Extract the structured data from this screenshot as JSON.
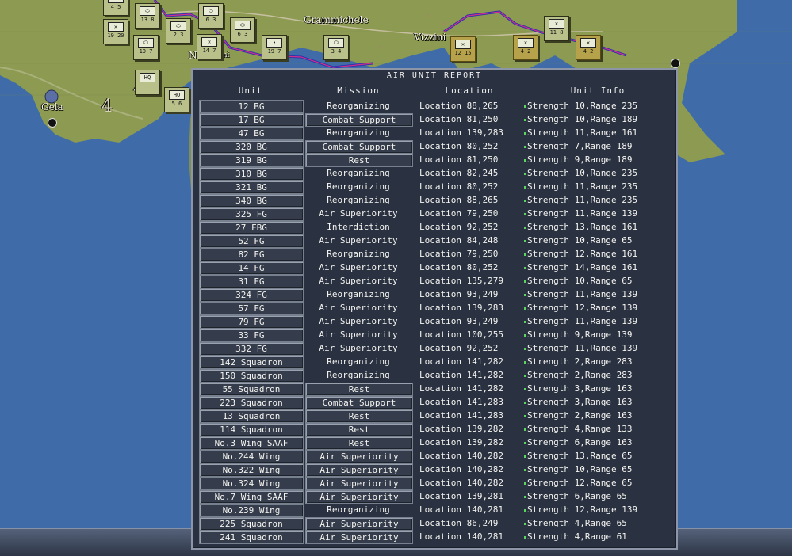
{
  "map": {
    "towns": [
      {
        "name": "Grammichele",
        "label": "Grammichele"
      },
      {
        "name": "Vizzini",
        "label": "Vizzini"
      },
      {
        "name": "Gela",
        "label": "Gela"
      },
      {
        "name": "Niscemi-partial",
        "label": "N"
      },
      {
        "name": "Niscemi-partial-2",
        "label": "mi"
      }
    ],
    "hex_number_label": "4",
    "counters": [
      {
        "label": "4 5",
        "sym": ""
      },
      {
        "label": "13 8",
        "sym": "⬭"
      },
      {
        "label": "6 3",
        "sym": "⬭"
      },
      {
        "label": "19 20",
        "sym": "✕"
      },
      {
        "label": "2 3",
        "sym": "⬭"
      },
      {
        "label": "14 7",
        "sym": "✕"
      },
      {
        "label": "6 3",
        "sym": "⬭"
      },
      {
        "label": "19 7",
        "sym": "•"
      },
      {
        "label": "10 7",
        "sym": "⬭"
      },
      {
        "label": "HQ",
        "sym": "HQ"
      },
      {
        "label": "5 6",
        "sym": "HQ"
      },
      {
        "label": "3 4",
        "sym": "⬭"
      },
      {
        "label": "11 8",
        "sym": "✕"
      },
      {
        "label": "12 15",
        "sym": "✕"
      },
      {
        "label": "4 2",
        "sym": "✕"
      },
      {
        "label": "4 2",
        "sym": "✕"
      }
    ]
  },
  "report": {
    "title": "AIR UNIT REPORT",
    "headers": {
      "unit": "Unit",
      "mission": "Mission",
      "location": "Location",
      "info": "Unit Info"
    },
    "rows": [
      {
        "unit": "12 BG",
        "mission": "Reorganizing",
        "boxed": false,
        "location": "Location 88,265",
        "info": "Strength 10,Range 235"
      },
      {
        "unit": "17 BG",
        "mission": "Combat Support",
        "boxed": true,
        "location": "Location 81,250",
        "info": "Strength 10,Range 189"
      },
      {
        "unit": "47 BG",
        "mission": "Reorganizing",
        "boxed": false,
        "location": "Location 139,283",
        "info": "Strength 11,Range 161"
      },
      {
        "unit": "320 BG",
        "mission": "Combat Support",
        "boxed": true,
        "location": "Location 80,252",
        "info": "Strength 7,Range 189"
      },
      {
        "unit": "319 BG",
        "mission": "Rest",
        "boxed": true,
        "location": "Location 81,250",
        "info": "Strength 9,Range 189"
      },
      {
        "unit": "310 BG",
        "mission": "Reorganizing",
        "boxed": false,
        "location": "Location 82,245",
        "info": "Strength 10,Range 235"
      },
      {
        "unit": "321 BG",
        "mission": "Reorganizing",
        "boxed": false,
        "location": "Location 80,252",
        "info": "Strength 11,Range 235"
      },
      {
        "unit": "340 BG",
        "mission": "Reorganizing",
        "boxed": false,
        "location": "Location 88,265",
        "info": "Strength 11,Range 235"
      },
      {
        "unit": "325 FG",
        "mission": "Air Superiority",
        "boxed": false,
        "location": "Location 79,250",
        "info": "Strength 11,Range 139"
      },
      {
        "unit": "27 FBG",
        "mission": "Interdiction",
        "boxed": false,
        "location": "Location 92,252",
        "info": "Strength 13,Range 161"
      },
      {
        "unit": "52 FG",
        "mission": "Air Superiority",
        "boxed": false,
        "location": "Location 84,248",
        "info": "Strength 10,Range 65"
      },
      {
        "unit": "82 FG",
        "mission": "Reorganizing",
        "boxed": false,
        "location": "Location 79,250",
        "info": "Strength 12,Range 161"
      },
      {
        "unit": "14 FG",
        "mission": "Air Superiority",
        "boxed": false,
        "location": "Location 80,252",
        "info": "Strength 14,Range 161"
      },
      {
        "unit": "31 FG",
        "mission": "Air Superiority",
        "boxed": false,
        "location": "Location 135,279",
        "info": "Strength 10,Range 65"
      },
      {
        "unit": "324 FG",
        "mission": "Reorganizing",
        "boxed": false,
        "location": "Location 93,249",
        "info": "Strength 11,Range 139"
      },
      {
        "unit": "57 FG",
        "mission": "Air Superiority",
        "boxed": false,
        "location": "Location 139,283",
        "info": "Strength 12,Range 139"
      },
      {
        "unit": "79 FG",
        "mission": "Air Superiority",
        "boxed": false,
        "location": "Location 93,249",
        "info": "Strength 11,Range 139"
      },
      {
        "unit": "33 FG",
        "mission": "Air Superiority",
        "boxed": false,
        "location": "Location 100,255",
        "info": "Strength 9,Range 139"
      },
      {
        "unit": "332 FG",
        "mission": "Air Superiority",
        "boxed": false,
        "location": "Location 92,252",
        "info": "Strength 11,Range 139"
      },
      {
        "unit": "142 Squadron",
        "mission": "Reorganizing",
        "boxed": false,
        "location": "Location 141,282",
        "info": "Strength 2,Range 283"
      },
      {
        "unit": "150 Squadron",
        "mission": "Reorganizing",
        "boxed": false,
        "location": "Location 141,282",
        "info": "Strength 2,Range 283"
      },
      {
        "unit": "55 Squadron",
        "mission": "Rest",
        "boxed": true,
        "location": "Location 141,282",
        "info": "Strength 3,Range 163"
      },
      {
        "unit": "223 Squadron",
        "mission": "Combat Support",
        "boxed": true,
        "location": "Location 141,283",
        "info": "Strength 3,Range 163"
      },
      {
        "unit": "13 Squadron",
        "mission": "Rest",
        "boxed": true,
        "location": "Location 141,283",
        "info": "Strength 2,Range 163"
      },
      {
        "unit": "114 Squadron",
        "mission": "Rest",
        "boxed": true,
        "location": "Location 139,282",
        "info": "Strength 4,Range 133"
      },
      {
        "unit": "No.3 Wing SAAF",
        "mission": "Rest",
        "boxed": true,
        "location": "Location 139,282",
        "info": "Strength 6,Range 163"
      },
      {
        "unit": "No.244 Wing",
        "mission": "Air Superiority",
        "boxed": true,
        "location": "Location 140,282",
        "info": "Strength 13,Range 65"
      },
      {
        "unit": "No.322 Wing",
        "mission": "Air Superiority",
        "boxed": true,
        "location": "Location 140,282",
        "info": "Strength 10,Range 65"
      },
      {
        "unit": "No.324 Wing",
        "mission": "Air Superiority",
        "boxed": true,
        "location": "Location 140,282",
        "info": "Strength 12,Range 65"
      },
      {
        "unit": "No.7 Wing SAAF",
        "mission": "Air Superiority",
        "boxed": true,
        "location": "Location 139,281",
        "info": "Strength 6,Range 65"
      },
      {
        "unit": "No.239 Wing",
        "mission": "Reorganizing",
        "boxed": false,
        "location": "Location 140,281",
        "info": "Strength 12,Range 139"
      },
      {
        "unit": "225 Squadron",
        "mission": "Air Superiority",
        "boxed": true,
        "location": "Location 86,249",
        "info": "Strength 4,Range 65"
      },
      {
        "unit": "241 Squadron",
        "mission": "Air Superiority",
        "boxed": true,
        "location": "Location 140,281",
        "info": "Strength 4,Range 61"
      }
    ]
  }
}
